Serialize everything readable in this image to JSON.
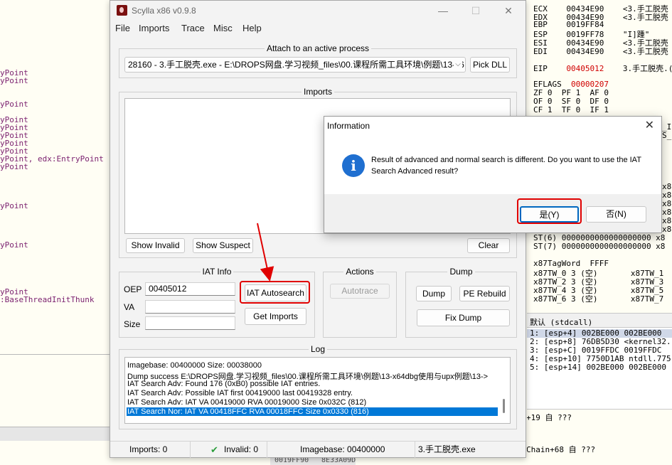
{
  "bg_left": {
    "lines": [
      "yPoint",
      "yPoint",
      "yPoint",
      "yPoint",
      "yPoint",
      "yPoint",
      "yPoint",
      "yPoint",
      "yPoint, edx:EntryPoint",
      "yPoint",
      "yPoint",
      "yPoint",
      "yPoint",
      ":BaseThreadInitThunk"
    ]
  },
  "bg_right": {
    "regs": [
      {
        "n": "ECX",
        "v": "00434E90",
        "c": "<3.手工脱壳"
      },
      {
        "n": "EDX",
        "v": "00434E90",
        "c": "<3.手工脱壳"
      },
      {
        "n": "EBP",
        "v": "0019FF84",
        "c": ""
      },
      {
        "n": "ESP",
        "v": "0019FF78",
        "c": "\"I]踵\""
      },
      {
        "n": "ESI",
        "v": "00434E90",
        "c": "<3.手工脱壳"
      },
      {
        "n": "EDI",
        "v": "00434E90",
        "c": "<3.手工脱壳"
      }
    ],
    "eip": {
      "n": "EIP",
      "v": "00405012",
      "c": "3.手工脱壳.("
    },
    "eflags": {
      "n": "EFLAGS",
      "v": "00000207"
    },
    "flags": [
      "ZF 0  PF 1  AF 0",
      "OF 0  SF 0  DF 0",
      "CF 1  TF 0  IF 1"
    ],
    "side": [
      "_IN",
      "S_B"
    ],
    "x8": [
      "x8",
      "x8",
      "x8",
      "x8",
      "x8",
      "x8"
    ],
    "st": [
      "ST(6) 0000000000000000000 x8",
      "ST(7) 0000000000000000000 x8"
    ],
    "tag": [
      "x87TagWord  FFFF",
      "x87TW_0 3 (空)       x87TW_1",
      "x87TW_2 3 (空)       x87TW_3",
      "x87TW_4 3 (空)       x87TW_5",
      "x87TW_6 3 (空)       x87TW_7"
    ],
    "stack_head": "默认 (stdcall)",
    "stack": [
      "1: [esp+4] 002BE000 002BE000",
      "2: [esp+8] 76DB5D30 <kernel32.",
      "3: [esp+C] 0019FFDC 0019FFDC",
      "4: [esp+10] 7750D1AB ntdll.775",
      "5: [esp+14] 002BE000 002BE000"
    ],
    "bottom": [
      "+19 自 ???",
      "Chain+68 自 ???"
    ],
    "bottom_cells": [
      "0019FF90",
      "8E33A09D"
    ]
  },
  "scylla": {
    "title": "Scylla x86 v0.9.8",
    "menu": [
      "File",
      "Imports",
      "Trace",
      "Misc",
      "Help"
    ],
    "attach_label": "Attach to an active process",
    "process_value": "28160 - 3.手工脱壳.exe - E:\\DROPS网盘.学习视频_files\\00.课程所需工具环境\\例题\\13-x6",
    "pick_dll": "Pick DLL",
    "imports_label": "Imports",
    "show_invalid": "Show Invalid",
    "show_suspect": "Show Suspect",
    "clear": "Clear",
    "iat_info_label": "IAT Info",
    "oep_label": "OEP",
    "oep_value": "00405012",
    "va_label": "VA",
    "size_label": "Size",
    "iat_autosearch": "IAT Autosearch",
    "get_imports": "Get Imports",
    "actions_label": "Actions",
    "autotrace": "Autotrace",
    "dump_label": "Dump",
    "dump": "Dump",
    "pe_rebuild": "PE Rebuild",
    "fix_dump": "Fix Dump",
    "log_label": "Log",
    "log": [
      "Imagebase: 00400000 Size: 00038000",
      "Dump success E:\\DROPS网盘.学习视频_files\\00.课程所需工具环境\\例题\\13-x64dbg使用与upx例题\\13->",
      "IAT Search Adv: Found 176 (0xB0) possible IAT entries.",
      "IAT Search Adv: Possible IAT first 00419000 last 00419328 entry.",
      "IAT Search Adv: IAT VA 00419000 RVA 00019000 Size 0x032C (812)",
      "IAT Search Nor: IAT VA 00418FFC RVA 00018FFC Size 0x0330 (816)"
    ],
    "status": {
      "imports": "Imports: 0",
      "invalid": "Invalid: 0",
      "imagebase": "Imagebase: 00400000",
      "module": "3.手工脱壳.exe"
    }
  },
  "dialog": {
    "title": "Information",
    "icon": "i",
    "message": "Result of advanced and normal search is different. Do you want to use the IAT Search Advanced result?",
    "yes": "是(Y)",
    "no": "否(N)"
  },
  "colors": {
    "accent": "#0078d7",
    "annotation": "#e00000",
    "info_icon": "#1f6fd0"
  }
}
